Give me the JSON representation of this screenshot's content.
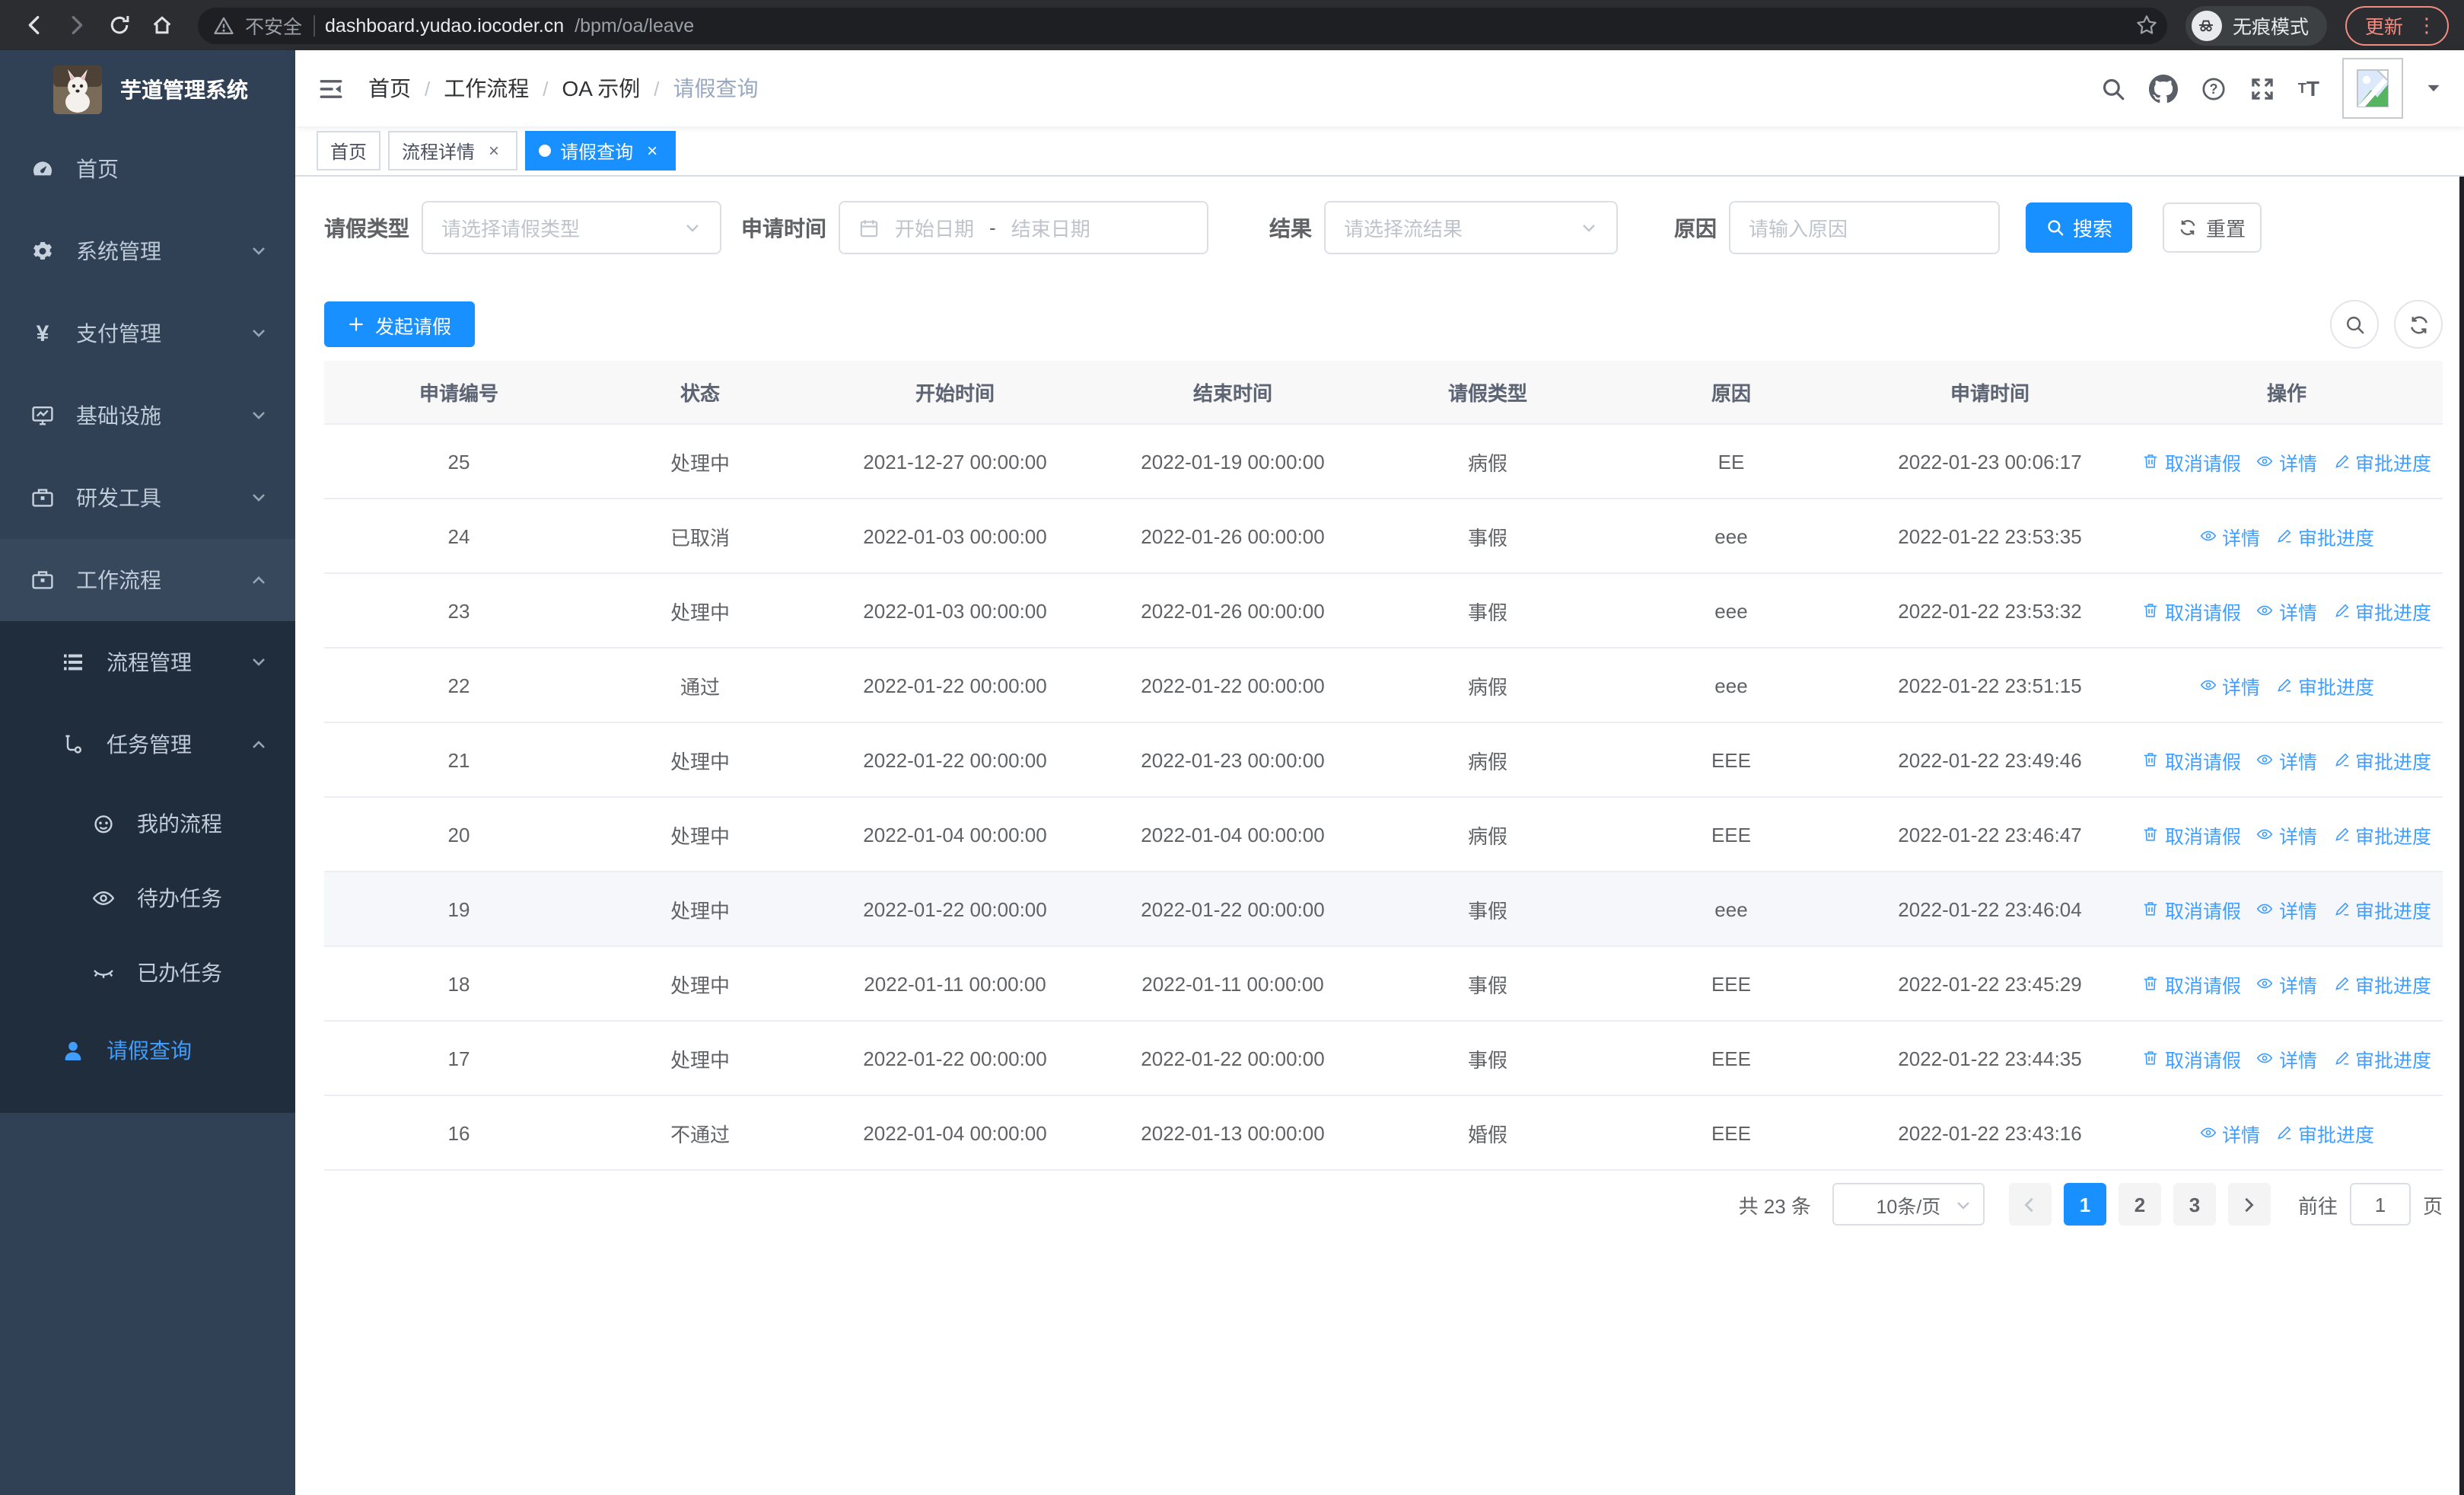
{
  "browser": {
    "security_label": "不安全",
    "url_host": "dashboard.yudao.iocoder.cn",
    "url_path": "/bpm/oa/leave",
    "incognito_label": "无痕模式",
    "update_label": "更新",
    "more_dots": "⋮"
  },
  "sidebar": {
    "app_title": "芋道管理系统",
    "items": [
      {
        "label": "首页"
      },
      {
        "label": "系统管理"
      },
      {
        "label": "支付管理"
      },
      {
        "label": "基础设施"
      },
      {
        "label": "研发工具"
      },
      {
        "label": "工作流程"
      },
      {
        "label": "流程管理"
      },
      {
        "label": "任务管理"
      },
      {
        "label": "我的流程"
      },
      {
        "label": "待办任务"
      },
      {
        "label": "已办任务"
      },
      {
        "label": "请假查询"
      }
    ],
    "yen_glyph": "¥"
  },
  "navbar": {
    "breadcrumb": {
      "separator": "/",
      "items": [
        "首页",
        "工作流程",
        "OA 示例",
        "请假查询"
      ]
    }
  },
  "tabs": [
    {
      "label": "首页"
    },
    {
      "label": "流程详情",
      "close": "×"
    },
    {
      "label": "请假查询",
      "close": "×"
    }
  ],
  "filters": {
    "leave_type": {
      "label": "请假类型",
      "placeholder": "请选择请假类型"
    },
    "apply_time": {
      "label": "申请时间",
      "start_placeholder": "开始日期",
      "separator": "-",
      "end_placeholder": "结束日期"
    },
    "result": {
      "label": "结果",
      "placeholder": "请选择流结果"
    },
    "reason": {
      "label": "原因",
      "placeholder": "请输入原因"
    },
    "search_label": "搜索",
    "reset_label": "重置"
  },
  "toolbar": {
    "create_label": "发起请假"
  },
  "table": {
    "columns": [
      "申请编号",
      "状态",
      "开始时间",
      "结束时间",
      "请假类型",
      "原因",
      "申请时间",
      "操作"
    ],
    "action_labels": {
      "cancel": "取消请假",
      "detail": "详情",
      "progress": "审批进度"
    },
    "rows": [
      {
        "id": "25",
        "status": "处理中",
        "start": "2021-12-27 00:00:00",
        "end": "2022-01-19 00:00:00",
        "type": "病假",
        "reason": "EE",
        "apply": "2022-01-23 00:06:17"
      },
      {
        "id": "24",
        "status": "已取消",
        "start": "2022-01-03 00:00:00",
        "end": "2022-01-26 00:00:00",
        "type": "事假",
        "reason": "eee",
        "apply": "2022-01-22 23:53:35"
      },
      {
        "id": "23",
        "status": "处理中",
        "start": "2022-01-03 00:00:00",
        "end": "2022-01-26 00:00:00",
        "type": "事假",
        "reason": "eee",
        "apply": "2022-01-22 23:53:32"
      },
      {
        "id": "22",
        "status": "通过",
        "start": "2022-01-22 00:00:00",
        "end": "2022-01-22 00:00:00",
        "type": "病假",
        "reason": "eee",
        "apply": "2022-01-22 23:51:15"
      },
      {
        "id": "21",
        "status": "处理中",
        "start": "2022-01-22 00:00:00",
        "end": "2022-01-23 00:00:00",
        "type": "病假",
        "reason": "EEE",
        "apply": "2022-01-22 23:49:46"
      },
      {
        "id": "20",
        "status": "处理中",
        "start": "2022-01-04 00:00:00",
        "end": "2022-01-04 00:00:00",
        "type": "病假",
        "reason": "EEE",
        "apply": "2022-01-22 23:46:47"
      },
      {
        "id": "19",
        "status": "处理中",
        "start": "2022-01-22 00:00:00",
        "end": "2022-01-22 00:00:00",
        "type": "事假",
        "reason": "eee",
        "apply": "2022-01-22 23:46:04"
      },
      {
        "id": "18",
        "status": "处理中",
        "start": "2022-01-11 00:00:00",
        "end": "2022-01-11 00:00:00",
        "type": "事假",
        "reason": "EEE",
        "apply": "2022-01-22 23:45:29"
      },
      {
        "id": "17",
        "status": "处理中",
        "start": "2022-01-22 00:00:00",
        "end": "2022-01-22 00:00:00",
        "type": "事假",
        "reason": "EEE",
        "apply": "2022-01-22 23:44:35"
      },
      {
        "id": "16",
        "status": "不通过",
        "start": "2022-01-04 00:00:00",
        "end": "2022-01-13 00:00:00",
        "type": "婚假",
        "reason": "EEE",
        "apply": "2022-01-22 23:43:16"
      }
    ]
  },
  "pagination": {
    "total_label": "共 23 条",
    "page_size": "10条/页",
    "pages": [
      "1",
      "2",
      "3"
    ],
    "active_page": "1",
    "goto_label": "前往",
    "goto_value": "1",
    "page_suffix": "页"
  },
  "colors": {
    "primary": "#1890ff",
    "link": "#409eff",
    "sidebar-bg": "#304156",
    "sidebar-submenu-bg": "#1f2d3d",
    "sidebar-active": "#409eff",
    "update-badge": "#f28b82"
  }
}
